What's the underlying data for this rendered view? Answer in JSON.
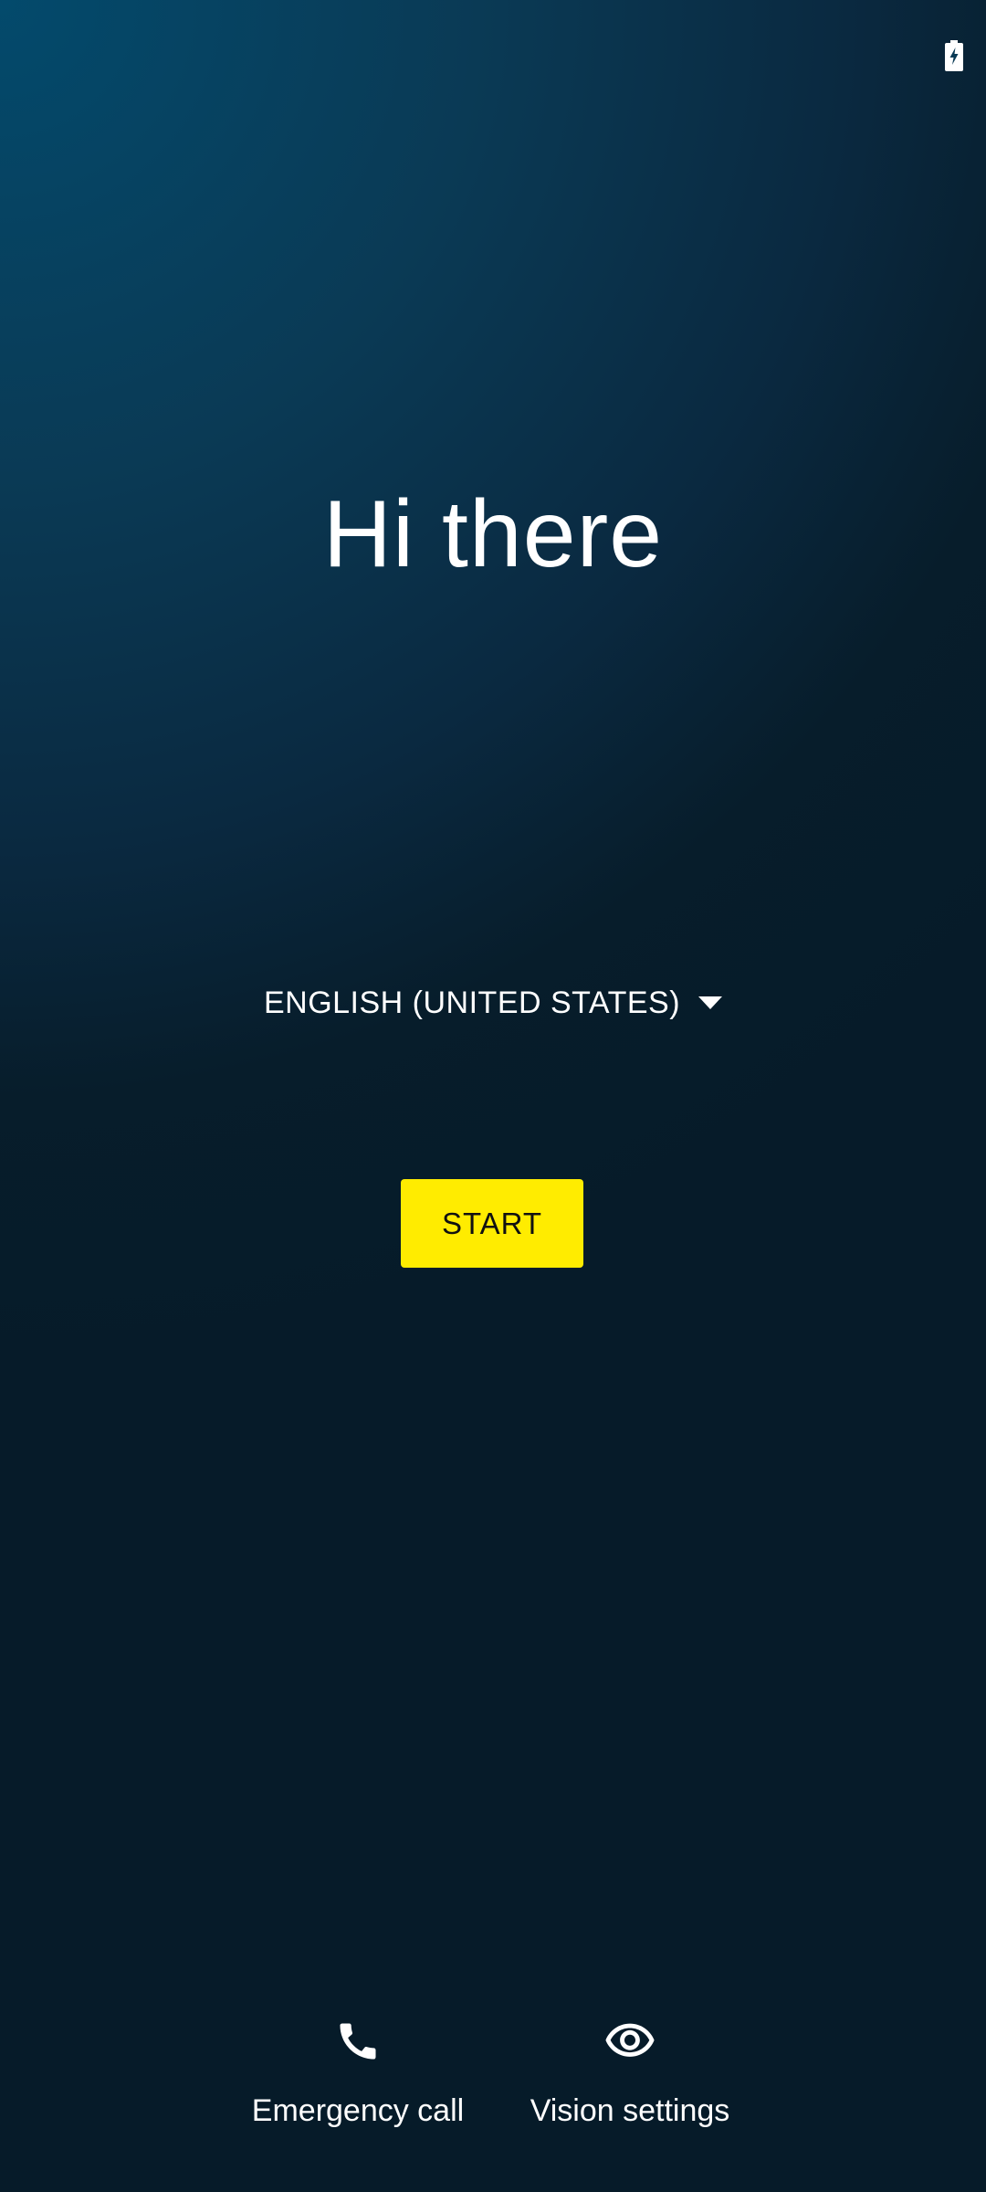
{
  "status_bar": {
    "battery_icon": "battery-charging-icon"
  },
  "welcome": {
    "greeting": "Hi there"
  },
  "language": {
    "selected": "ENGLISH (UNITED STATES)",
    "dropdown_icon": "chevron-down-icon"
  },
  "start_button": {
    "label": "START",
    "color": "#ffec00"
  },
  "bottom_actions": {
    "emergency": {
      "label": "Emergency call",
      "icon": "phone-icon"
    },
    "vision": {
      "label": "Vision settings",
      "icon": "eye-icon"
    }
  },
  "colors": {
    "background_top": "#034a6c",
    "background_bottom": "#061b29",
    "text": "#ffffff",
    "accent": "#ffec00"
  }
}
